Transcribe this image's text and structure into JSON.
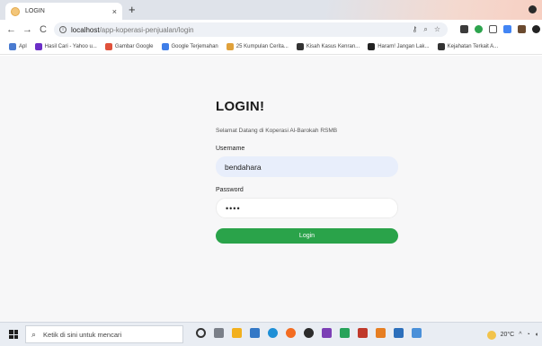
{
  "browser": {
    "tab_title": "LOGIN",
    "tab_close": "×",
    "new_tab": "+",
    "nav": {
      "back": "←",
      "forward": "→",
      "reload": "C"
    },
    "url_host": "localhost",
    "url_path": "/app-koperasi-penjualan/login",
    "bookmarks": [
      {
        "label": "Apl",
        "color": "#4a7bd0"
      },
      {
        "label": "Hasil Cari - Yahoo u...",
        "color": "#6b2fc7"
      },
      {
        "label": "Gambar Google",
        "color": "#e0513b"
      },
      {
        "label": "Google Terjemahan",
        "color": "#3f7ee8"
      },
      {
        "label": "25 Kumpulan Cerita...",
        "color": "#e0a13b"
      },
      {
        "label": "Kisah Kasus Kenran...",
        "color": "#333333"
      },
      {
        "label": "Haram! Jangan Lak...",
        "color": "#222222"
      },
      {
        "label": "Kejahatan Terkait A...",
        "color": "#333333"
      }
    ]
  },
  "login": {
    "title": "LOGIN!",
    "welcome": "Selamat Datang di Koperasi Al-Barokah RSMB",
    "username_label": "Username",
    "username_value": "bendahara",
    "password_label": "Password",
    "password_value": "••••",
    "button_label": "Login"
  },
  "taskbar": {
    "search_placeholder": "Ketik di sini untuk mencari",
    "temperature": "20°C",
    "tray_symbols": "^"
  },
  "colors": {
    "login_button": "#2aa34a",
    "username_field": "#e8eefb",
    "page_background": "#f7f7f8"
  }
}
